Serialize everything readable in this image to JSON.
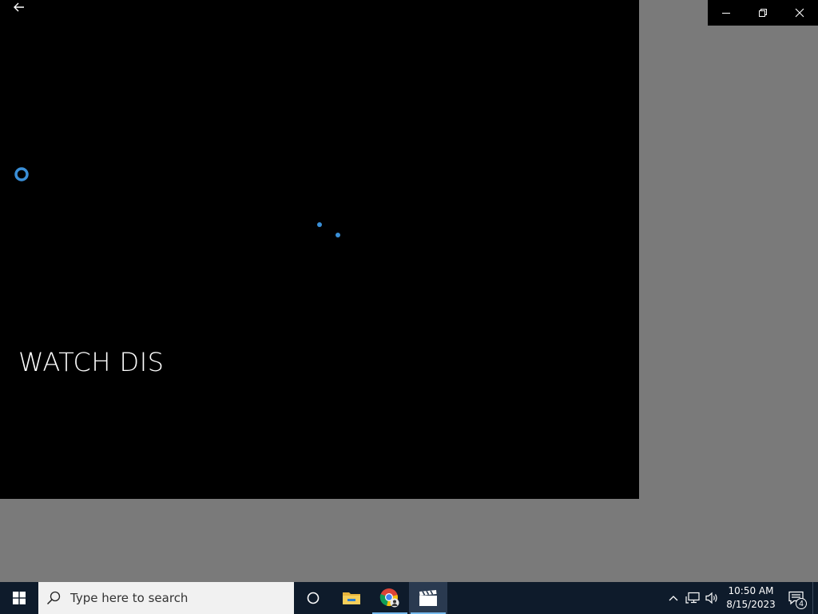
{
  "app": {
    "caption": "WATCH DIS",
    "background": "#000000",
    "accent": "#3a8fd8"
  },
  "window_controls": {
    "icons": [
      "minimize-icon",
      "restore-icon",
      "close-icon"
    ]
  },
  "taskbar": {
    "search_placeholder": "Type here to search",
    "apps": [
      "cortana",
      "file-explorer",
      "chrome",
      "movies-and-tv"
    ],
    "clock": {
      "time": "10:50 AM",
      "date": "8/15/2023"
    },
    "notification_count": "4",
    "background": "#0e1b2b"
  }
}
